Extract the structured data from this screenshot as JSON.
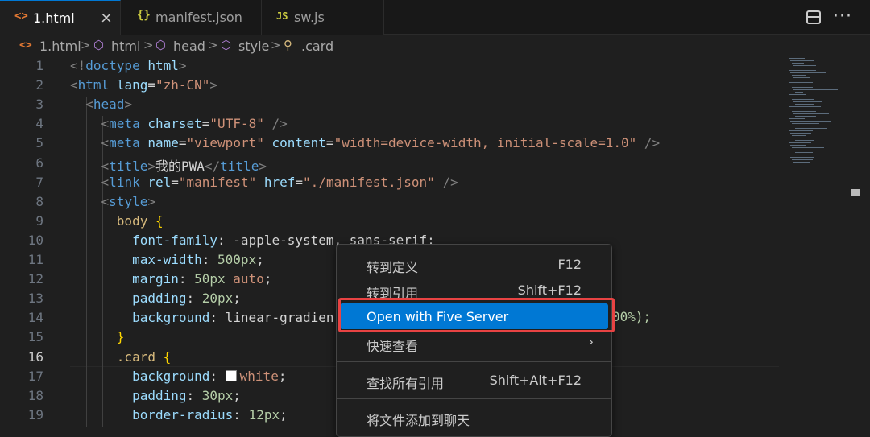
{
  "tabs": [
    {
      "label": "1.html",
      "icon": "<>",
      "icon_color": "#e37933"
    },
    {
      "label": "manifest.json",
      "icon": "{}",
      "icon_color": "#cbcb41"
    },
    {
      "label": "sw.js",
      "icon": "JS",
      "icon_color": "#cbcb41"
    }
  ],
  "tab_close": "×",
  "breadcrumb": [
    {
      "label": "1.html",
      "icon": "<>"
    },
    {
      "label": "html",
      "icon": "⬡"
    },
    {
      "label": "head",
      "icon": "⬡"
    },
    {
      "label": "style",
      "icon": "⬡"
    },
    {
      "label": ".card",
      "icon": "⚲"
    }
  ],
  "breadcrumb_sep": ">",
  "editor": {
    "line_numbers": [
      "1",
      "2",
      "3",
      "4",
      "5",
      "6",
      "7",
      "8",
      "9",
      "10",
      "11",
      "12",
      "13",
      "14",
      "15",
      "16",
      "17",
      "18",
      "19"
    ],
    "current_line": "16",
    "lines": [
      {
        "tokens": [
          [
            "p",
            "<!"
          ],
          [
            "t",
            "doctype"
          ],
          [
            "w",
            " "
          ],
          [
            "a",
            "html"
          ],
          [
            "p",
            ">"
          ]
        ]
      },
      {
        "tokens": [
          [
            "p",
            "<"
          ],
          [
            "t",
            "html"
          ],
          [
            "w",
            " "
          ],
          [
            "a",
            "lang"
          ],
          [
            "w",
            "="
          ],
          [
            "s",
            "\"zh-CN\""
          ],
          [
            "p",
            ">"
          ]
        ]
      },
      {
        "tokens": [
          [
            "w",
            "  "
          ],
          [
            "p",
            "<"
          ],
          [
            "t",
            "head"
          ],
          [
            "p",
            ">"
          ]
        ]
      },
      {
        "tokens": [
          [
            "w",
            "    "
          ],
          [
            "p",
            "<"
          ],
          [
            "t",
            "meta"
          ],
          [
            "w",
            " "
          ],
          [
            "a",
            "charset"
          ],
          [
            "w",
            "="
          ],
          [
            "s",
            "\"UTF-8\""
          ],
          [
            "w",
            " "
          ],
          [
            "p",
            "/>"
          ]
        ]
      },
      {
        "tokens": [
          [
            "w",
            "    "
          ],
          [
            "p",
            "<"
          ],
          [
            "t",
            "meta"
          ],
          [
            "w",
            " "
          ],
          [
            "a",
            "name"
          ],
          [
            "w",
            "="
          ],
          [
            "s",
            "\"viewport\""
          ],
          [
            "w",
            " "
          ],
          [
            "a",
            "content"
          ],
          [
            "w",
            "="
          ],
          [
            "s",
            "\"width=device-width, initial-scale=1.0\""
          ],
          [
            "w",
            " "
          ],
          [
            "p",
            "/>"
          ]
        ]
      },
      {
        "tokens": [
          [
            "w",
            "    "
          ],
          [
            "p",
            "<"
          ],
          [
            "t",
            "title"
          ],
          [
            "p",
            ">"
          ],
          [
            "w",
            "我的PWA"
          ],
          [
            "p",
            "</"
          ],
          [
            "t",
            "title"
          ],
          [
            "p",
            ">"
          ]
        ]
      },
      {
        "tokens": [
          [
            "w",
            "    "
          ],
          [
            "p",
            "<"
          ],
          [
            "t",
            "link"
          ],
          [
            "w",
            " "
          ],
          [
            "a",
            "rel"
          ],
          [
            "w",
            "="
          ],
          [
            "s",
            "\"manifest\""
          ],
          [
            "w",
            " "
          ],
          [
            "a",
            "href"
          ],
          [
            "w",
            "="
          ],
          [
            "s",
            "\""
          ],
          [
            "su",
            "./manifest.json"
          ],
          [
            "s",
            "\""
          ],
          [
            "w",
            " "
          ],
          [
            "p",
            "/>"
          ]
        ]
      },
      {
        "tokens": [
          [
            "w",
            "    "
          ],
          [
            "p",
            "<"
          ],
          [
            "t",
            "style"
          ],
          [
            "p",
            ">"
          ]
        ]
      },
      {
        "tokens": [
          [
            "w",
            "      "
          ],
          [
            "sel",
            "body"
          ],
          [
            "w",
            " "
          ],
          [
            "br",
            "{"
          ]
        ]
      },
      {
        "tokens": [
          [
            "w",
            "        "
          ],
          [
            "a",
            "font-family"
          ],
          [
            "w",
            ": "
          ],
          [
            "w",
            "-apple-system, sans-serif;"
          ]
        ]
      },
      {
        "tokens": [
          [
            "w",
            "        "
          ],
          [
            "a",
            "max-width"
          ],
          [
            "w",
            ": "
          ],
          [
            "num",
            "500px"
          ],
          [
            "w",
            ";"
          ]
        ]
      },
      {
        "tokens": [
          [
            "w",
            "        "
          ],
          [
            "a",
            "margin"
          ],
          [
            "w",
            ": "
          ],
          [
            "num",
            "50px"
          ],
          [
            "w",
            " "
          ],
          [
            "s",
            "auto"
          ],
          [
            "w",
            ";"
          ]
        ]
      },
      {
        "tokens": [
          [
            "w",
            "        "
          ],
          [
            "a",
            "padding"
          ],
          [
            "w",
            ": "
          ],
          [
            "num",
            "20px"
          ],
          [
            "w",
            ";"
          ]
        ]
      },
      {
        "tokens": [
          [
            "w",
            "        "
          ],
          [
            "a",
            "background"
          ],
          [
            "w",
            ": "
          ],
          [
            "w",
            "linear-gradien"
          ]
        ]
      },
      {
        "tokens": [
          [
            "w",
            "      "
          ],
          [
            "br",
            "}"
          ]
        ]
      },
      {
        "tokens": [
          [
            "w",
            "      "
          ],
          [
            "sel",
            ".card"
          ],
          [
            "w",
            " "
          ],
          [
            "br",
            "{"
          ]
        ]
      },
      {
        "tokens": [
          [
            "w",
            "        "
          ],
          [
            "a",
            "background"
          ],
          [
            "w",
            ": "
          ],
          [
            "swatch",
            ""
          ],
          [
            "s",
            "white"
          ],
          [
            "w",
            ";"
          ]
        ]
      },
      {
        "tokens": [
          [
            "w",
            "        "
          ],
          [
            "a",
            "padding"
          ],
          [
            "w",
            ": "
          ],
          [
            "num",
            "30px"
          ],
          [
            "w",
            ";"
          ]
        ]
      },
      {
        "tokens": [
          [
            "w",
            "        "
          ],
          [
            "a",
            "border-radius"
          ],
          [
            "w",
            ": "
          ],
          [
            "num",
            "12px"
          ],
          [
            "w",
            ";"
          ]
        ]
      }
    ],
    "line14_tail": "00%);"
  },
  "context_menu": {
    "items": [
      {
        "label": "转到定义",
        "shortcut": "F12"
      },
      {
        "label": "转到引用",
        "shortcut": "Shift+F12"
      },
      {
        "label": "Open with Five Server",
        "shortcut": ""
      },
      {
        "label": "快速查看",
        "shortcut": ""
      },
      {
        "label": "查找所有引用",
        "shortcut": "Shift+Alt+F12"
      },
      {
        "label": "将文件添加到聊天",
        "shortcut": ""
      }
    ],
    "submenu_glyph": "›"
  }
}
